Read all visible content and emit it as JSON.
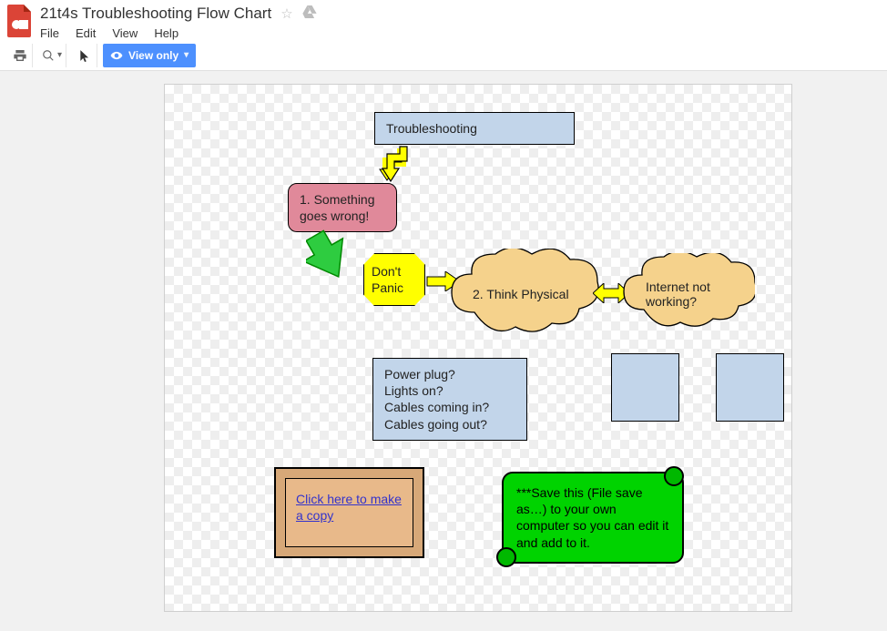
{
  "header": {
    "title": "21t4s Troubleshooting Flow Chart",
    "menus": {
      "file": "File",
      "edit": "Edit",
      "view": "View",
      "help": "Help"
    }
  },
  "toolbar": {
    "view_only_label": "View only"
  },
  "diagram": {
    "title_box": "Troubleshooting",
    "step1": "1. Something goes wrong!",
    "panic": "Don't Panic",
    "step2": "2. Think Physical",
    "internet": "Internet not working?",
    "checklist": "Power plug?\nLights on?\nCables coming in?\nCables going out?",
    "copy_link": "Click here to make a copy",
    "save_note": "***Save this (File save as…)  to your own computer so you can edit it and add to it."
  }
}
